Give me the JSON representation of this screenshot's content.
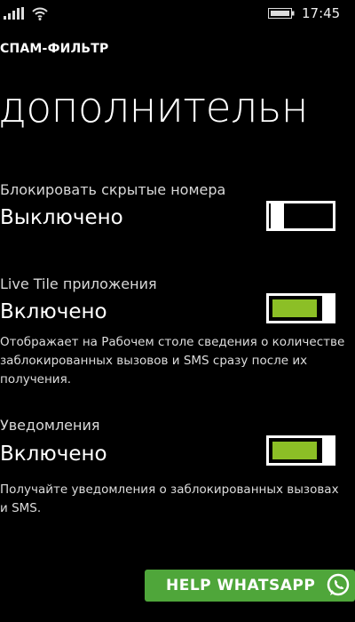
{
  "status_bar": {
    "time": "17:45",
    "signal_icon": "signal-bars-icon",
    "wifi_icon": "wifi-icon",
    "battery_icon": "battery-icon"
  },
  "header": {
    "app_title": "СПАМ-ФИЛЬТР",
    "page_title": "дополнительн"
  },
  "settings": [
    {
      "label": "Блокировать скрытые номера",
      "value": "Выключено",
      "state": "off",
      "description": ""
    },
    {
      "label": "Live Tile приложения",
      "value": "Включено",
      "state": "on",
      "description": "Отображает на Рабочем столе сведения о количестве заблокированных вызовов и SMS сразу после их получения."
    },
    {
      "label": "Уведомления",
      "value": "Включено",
      "state": "on",
      "description": "Получайте уведомления о заблокированных вызовах и SMS."
    }
  ],
  "watermark": {
    "text": "HELP WHATSAPP",
    "icon": "whatsapp-icon"
  },
  "colors": {
    "background": "#000000",
    "accent": "#8cbf26",
    "watermark": "#4fa63a"
  }
}
